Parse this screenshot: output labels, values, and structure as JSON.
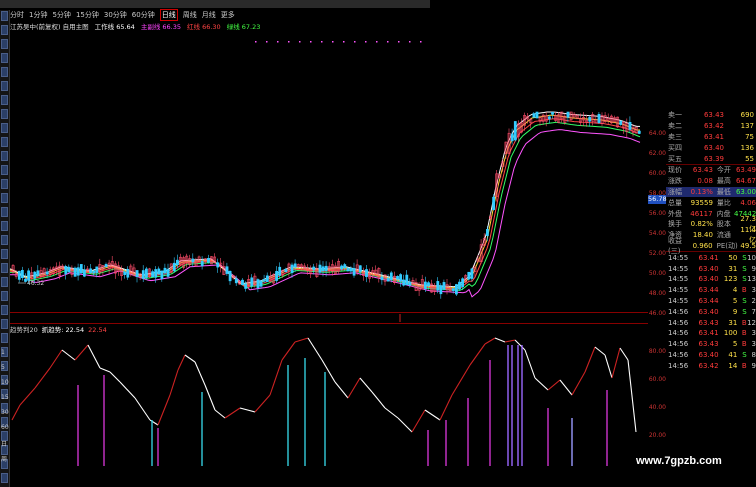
{
  "header": {
    "periods": [
      "分时",
      "1分钟",
      "5分钟",
      "15分钟",
      "30分钟",
      "60分钟",
      "日线",
      "周线",
      "月线",
      "更多"
    ],
    "active_period": "日线",
    "ma_legend": [
      {
        "label": "江苏吴中(前复权) 自用主图",
        "color": "#dddddd"
      },
      {
        "label": "工作线 65.64",
        "color": "#ffffff"
      },
      {
        "label": "主副线 66.35",
        "color": "#ff44ff"
      },
      {
        "label": "红线 66.30",
        "color": "#ff4444"
      },
      {
        "label": "绿线 67.23",
        "color": "#44ff44"
      }
    ]
  },
  "order_book": [
    {
      "label": "卖一",
      "price": "63.43",
      "vol": "690"
    },
    {
      "label": "卖二",
      "price": "63.42",
      "vol": "137"
    },
    {
      "label": "卖三",
      "price": "63.41",
      "vol": "75"
    },
    {
      "label": "买四",
      "price": "63.40",
      "vol": "136"
    },
    {
      "label": "买五",
      "price": "63.39",
      "vol": "55"
    }
  ],
  "quote": [
    {
      "l1": "现价",
      "v1": "63.43",
      "c1": "#ff3b3b",
      "l2": "今开",
      "v2": "63.49",
      "c2": "#ff3b3b"
    },
    {
      "l1": "涨跌",
      "v1": "0.08",
      "c1": "#ff3b3b",
      "l2": "最高",
      "v2": "64.67",
      "c2": "#ff3b3b"
    },
    {
      "l1": "涨幅",
      "v1": "0.13%",
      "c1": "#ff3b3b",
      "l2": "最低",
      "v2": "63.00",
      "c2": "#44ff44"
    },
    {
      "l1": "总量",
      "v1": "93559",
      "c1": "#ffe14a",
      "l2": "量比",
      "v2": "4.06",
      "c2": "#ff3b3b"
    },
    {
      "l1": "外盘",
      "v1": "46117",
      "c1": "#ff3b3b",
      "l2": "内盘",
      "v2": "47442",
      "c2": "#44ff44"
    },
    {
      "l1": "换手",
      "v1": "0.82%",
      "c1": "#ffe14a",
      "l2": "股本",
      "v2": "27.3亿",
      "c2": "#ffe14a"
    },
    {
      "l1": "净资",
      "v1": "18.40",
      "c1": "#ffe14a",
      "l2": "流通",
      "v2": "11.4亿",
      "c2": "#ffe14a"
    },
    {
      "l1": "收益(三)",
      "v1": "0.960",
      "c1": "#ffe14a",
      "l2": "PE(动)",
      "v2": "49.5",
      "c2": "#ffe14a"
    }
  ],
  "trades": [
    {
      "time": "14:55",
      "price": "63.41",
      "vol": "50",
      "dir": "S",
      "dcolor": "#44ff44",
      "num": "10"
    },
    {
      "time": "14:55",
      "price": "63.40",
      "vol": "31",
      "dir": "S",
      "dcolor": "#44ff44",
      "num": "9"
    },
    {
      "time": "14:55",
      "price": "63.40",
      "vol": "123",
      "dir": "S",
      "dcolor": "#44ff44",
      "num": "13"
    },
    {
      "time": "14:55",
      "price": "63.44",
      "vol": "4",
      "dir": "B",
      "dcolor": "#ff3b3b",
      "num": "3"
    },
    {
      "time": "14:55",
      "price": "63.44",
      "vol": "5",
      "dir": "S",
      "dcolor": "#44ff44",
      "num": "2"
    },
    {
      "time": "14:56",
      "price": "63.40",
      "vol": "9",
      "dir": "S",
      "dcolor": "#44ff44",
      "num": "7"
    },
    {
      "time": "14:56",
      "price": "63.43",
      "vol": "31",
      "dir": "B",
      "dcolor": "#ff3b3b",
      "num": "12"
    },
    {
      "time": "14:56",
      "price": "63.41",
      "vol": "100",
      "dir": "B",
      "dcolor": "#ff3b3b",
      "num": "3"
    },
    {
      "time": "14:56",
      "price": "63.43",
      "vol": "5",
      "dir": "B",
      "dcolor": "#ff3b3b",
      "num": "3"
    },
    {
      "time": "14:56",
      "price": "63.40",
      "vol": "41",
      "dir": "S",
      "dcolor": "#44ff44",
      "num": "8"
    },
    {
      "time": "14:56",
      "price": "63.42",
      "vol": "14",
      "dir": "B",
      "dcolor": "#ff3b3b",
      "num": "9"
    }
  ],
  "price_axis": [
    "64.00",
    "62.00",
    "60.00",
    "58.00",
    "56.00",
    "54.00",
    "52.00",
    "50.00",
    "48.00",
    "46.00"
  ],
  "indicator_axis": [
    "80.00",
    "60.00",
    "40.00",
    "20.00"
  ],
  "current_price_tag": "56.78",
  "low_label": "46.32",
  "indicator": {
    "name": "趋势判20",
    "label": "抓趋势: 22.54",
    "value": "22.54"
  },
  "left_axis_labels": [
    "1",
    "5",
    "10",
    "15",
    "30",
    "60",
    "日",
    "周"
  ],
  "watermark": "www.7gpzb.com",
  "colors": {
    "up": "#ff4d6a",
    "down": "#33ccff",
    "ma_yellow": "#ffdd33",
    "ma_green": "#33ff66",
    "ma_magenta": "#ff55ff",
    "ma_red": "#ff4444",
    "ma_white": "#ffffff"
  }
}
